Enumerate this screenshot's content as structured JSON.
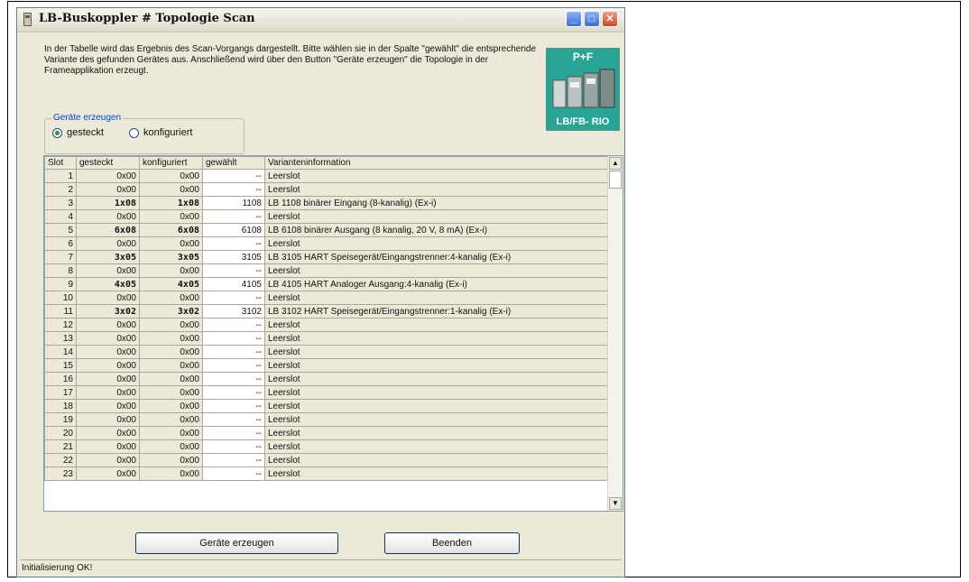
{
  "window": {
    "title": "LB-Buskoppler # Topologie Scan"
  },
  "description": "In der Tabelle wird das Ergebnis des Scan-Vorgangs dargestellt. Bitte wählen sie in der Spalte \"gewählt\" die entsprechende Variante des gefunden Gerätes aus. Anschließend wird über den Button \"Geräte erzeugen\" die Topologie in der Frameapplikation erzeugt.",
  "logo": {
    "top": "P+F",
    "bottom": "LB/FB- RIO"
  },
  "group": {
    "legend": "Geräte erzeugen",
    "options": [
      "gesteckt",
      "konfiguriert"
    ],
    "selected": "gesteckt"
  },
  "table": {
    "headers": [
      "Slot",
      "gesteckt",
      "konfiguriert",
      "gewählt",
      "Varianteninformation"
    ],
    "rows": [
      [
        "1",
        "0x00",
        "0x00",
        "--",
        "Leerslot"
      ],
      [
        "2",
        "0x00",
        "0x00",
        "--",
        "Leerslot"
      ],
      [
        "3",
        "1x08",
        "1x08",
        "1108",
        "LB 1108 binärer Eingang (8-kanalig) (Ex-i)"
      ],
      [
        "4",
        "0x00",
        "0x00",
        "--",
        "Leerslot"
      ],
      [
        "5",
        "6x08",
        "6x08",
        "6108",
        "LB 6108 binärer Ausgang (8 kanalig, 20 V, 8 mA) (Ex-i)"
      ],
      [
        "6",
        "0x00",
        "0x00",
        "--",
        "Leerslot"
      ],
      [
        "7",
        "3x05",
        "3x05",
        "3105",
        "LB 3105 HART Speisegerät/Eingangstrenner:4-kanalig (Ex-i)"
      ],
      [
        "8",
        "0x00",
        "0x00",
        "--",
        "Leerslot"
      ],
      [
        "9",
        "4x05",
        "4x05",
        "4105",
        "LB 4105 HART Analoger Ausgang:4-kanalig (Ex-i)"
      ],
      [
        "10",
        "0x00",
        "0x00",
        "--",
        "Leerslot"
      ],
      [
        "11",
        "3x02",
        "3x02",
        "3102",
        "LB 3102 HART Speisegerät/Eingangstrenner:1-kanalig (Ex-i)"
      ],
      [
        "12",
        "0x00",
        "0x00",
        "--",
        "Leerslot"
      ],
      [
        "13",
        "0x00",
        "0x00",
        "--",
        "Leerslot"
      ],
      [
        "14",
        "0x00",
        "0x00",
        "--",
        "Leerslot"
      ],
      [
        "15",
        "0x00",
        "0x00",
        "--",
        "Leerslot"
      ],
      [
        "16",
        "0x00",
        "0x00",
        "--",
        "Leerslot"
      ],
      [
        "17",
        "0x00",
        "0x00",
        "--",
        "Leerslot"
      ],
      [
        "18",
        "0x00",
        "0x00",
        "--",
        "Leerslot"
      ],
      [
        "19",
        "0x00",
        "0x00",
        "--",
        "Leerslot"
      ],
      [
        "20",
        "0x00",
        "0x00",
        "--",
        "Leerslot"
      ],
      [
        "21",
        "0x00",
        "0x00",
        "--",
        "Leerslot"
      ],
      [
        "22",
        "0x00",
        "0x00",
        "--",
        "Leerslot"
      ],
      [
        "23",
        "0x00",
        "0x00",
        "--",
        "Leerslot"
      ]
    ]
  },
  "buttons": {
    "create": "Geräte erzeugen",
    "exit": "Beenden"
  },
  "status": "Initialisierung OK!"
}
